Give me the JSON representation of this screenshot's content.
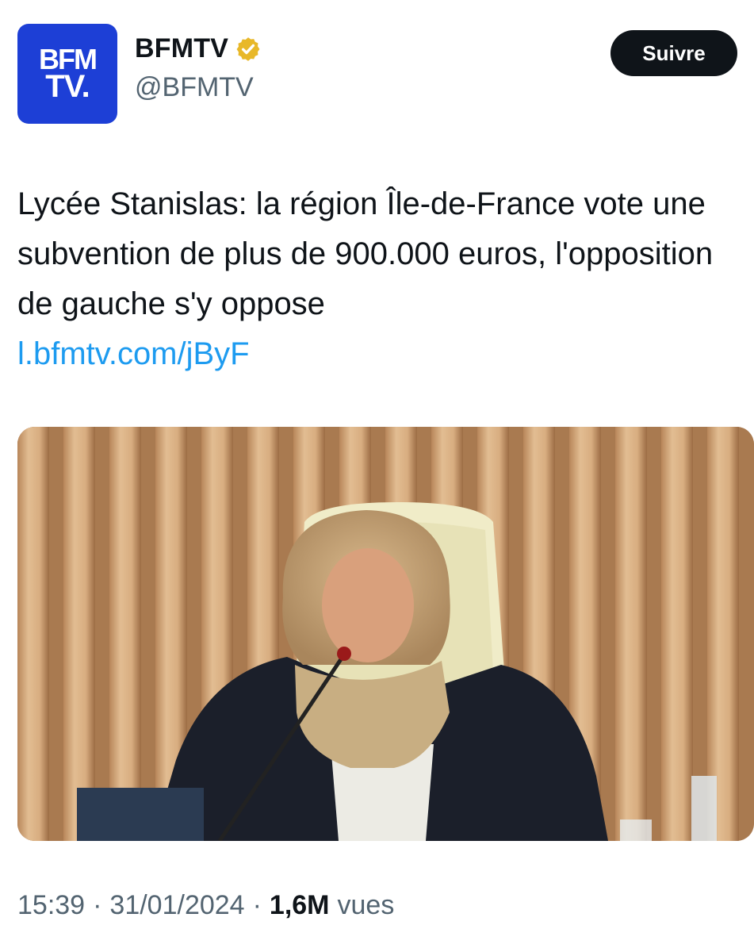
{
  "account": {
    "avatar_line1": "BFM",
    "avatar_line2": "TV.",
    "display_name": "BFMTV",
    "handle": "@BFMTV",
    "verified_icon": "gold-verified-badge-icon"
  },
  "follow_label": "Suivre",
  "tweet": {
    "text": "Lycée Stanislas: la région Île-de-France vote une subvention de plus de 900.000 euros, l'opposition de gauche s'y oppose",
    "link": "l.bfmtv.com/jByF"
  },
  "meta": {
    "time": "15:39",
    "date": "31/01/2024",
    "views_count": "1,6M",
    "views_label": "vues",
    "separator": "·"
  },
  "colors": {
    "link": "#1d9bf0",
    "secondary_text": "#536471",
    "primary_text": "#0f1419",
    "avatar_bg": "#1d3fd6",
    "verified_gold": "#e8b829"
  }
}
